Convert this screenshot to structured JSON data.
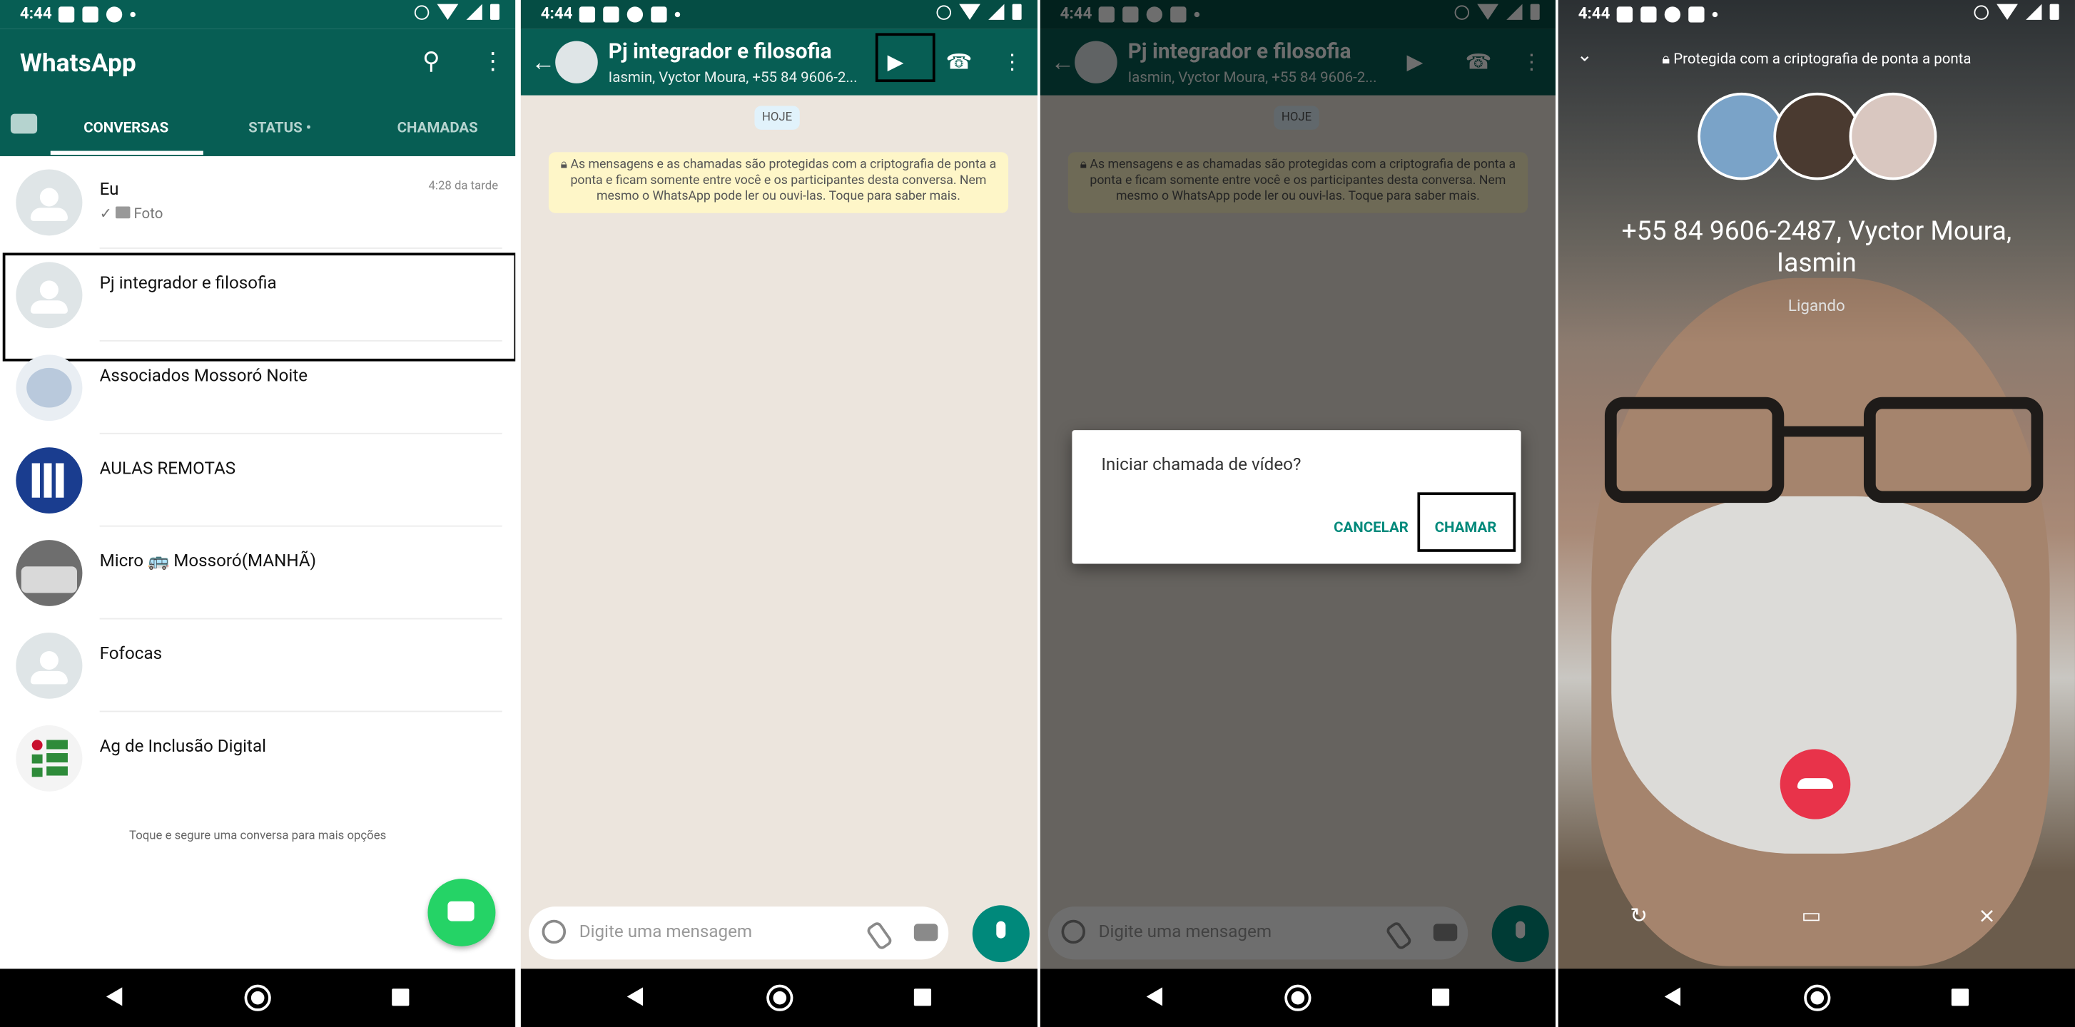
{
  "status_bar": {
    "time": "4:44"
  },
  "chat_list": {
    "app_title": "WhatsApp",
    "tabs": [
      "CONVERSAS",
      "STATUS",
      "CHAMADAS"
    ],
    "status_dot": "•",
    "chats": [
      {
        "name": "Eu",
        "time": "4:28 da tarde",
        "check": "✓",
        "sub": "Foto"
      },
      {
        "name": "Pj integrador e filosofia"
      },
      {
        "name": "Associados Mossoró Noite"
      },
      {
        "name": "AULAS REMOTAS"
      },
      {
        "name": "Micro 🚌 Mossoró(MANHÃ)"
      },
      {
        "name": "Fofocas"
      },
      {
        "name": "Ag de Inclusão Digital"
      }
    ],
    "hint": "Toque e segure uma conversa para mais opções"
  },
  "group_chat": {
    "title": "Pj integrador e filosofia",
    "subtitle": "Iasmin, Vyctor Moura, +55 84 9606-2...",
    "date_pill": "HOJE",
    "encryption_note": "As mensagens e as chamadas são protegidas com a criptografia de ponta a ponta e ficam somente entre você e os participantes desta conversa. Nem mesmo o WhatsApp pode ler ou ouvi-las. Toque para saber mais.",
    "input_placeholder": "Digite uma mensagem"
  },
  "dialog": {
    "text": "Iniciar chamada de vídeo?",
    "cancel": "CANCELAR",
    "call": "CHAMAR"
  },
  "call": {
    "encryption": "Protegida com a criptografia de ponta a ponta",
    "names": "+55 84 9606-2487, Vyctor Moura, Iasmin",
    "status": "Ligando"
  },
  "colors": {
    "header": "#075e54",
    "accent": "#25d366",
    "end_call": "#e8334a"
  },
  "icons": [
    "camera-icon",
    "search-icon",
    "more-vert-icon",
    "back-arrow-icon",
    "video-call-icon",
    "phone-icon",
    "emoji-icon",
    "attach-icon",
    "mic-icon",
    "chat-fab-icon",
    "end-call-icon",
    "switch-camera-icon",
    "video-off-icon",
    "mic-off-icon",
    "lock-icon",
    "chevron-down-icon"
  ]
}
